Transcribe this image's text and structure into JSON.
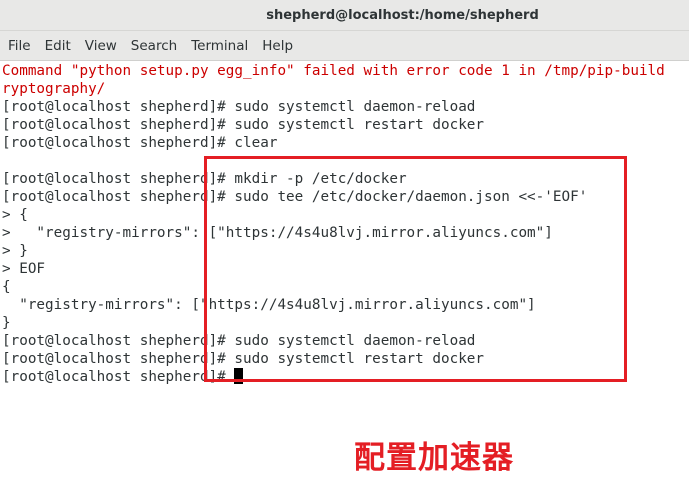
{
  "window": {
    "title": "shepherd@localhost:/home/shepherd"
  },
  "menubar": {
    "items": [
      "File",
      "Edit",
      "View",
      "Search",
      "Terminal",
      "Help"
    ]
  },
  "terminal": {
    "lines": [
      "Command \"python setup.py egg_info\" failed with error code 1 in /tmp/pip-build",
      "ryptography/",
      "[root@localhost shepherd]# sudo systemctl daemon-reload",
      "[root@localhost shepherd]# sudo systemctl restart docker",
      "[root@localhost shepherd]# clear",
      "",
      "[root@localhost shepherd]# mkdir -p /etc/docker",
      "[root@localhost shepherd]# sudo tee /etc/docker/daemon.json <<-'EOF'",
      "> {",
      ">   \"registry-mirrors\": [\"https://4s4u8lvj.mirror.aliyuncs.com\"]",
      "> }",
      "> EOF",
      "{",
      "  \"registry-mirrors\": [\"https://4s4u8lvj.mirror.aliyuncs.com\"]",
      "}",
      "[root@localhost shepherd]# sudo systemctl daemon-reload",
      "[root@localhost shepherd]# sudo systemctl restart docker",
      "[root@localhost shepherd]# "
    ],
    "error_color": "#cc0000",
    "text_color": "#2e3436"
  },
  "annotation": {
    "text": "配置加速器",
    "color": "#e41e24"
  }
}
